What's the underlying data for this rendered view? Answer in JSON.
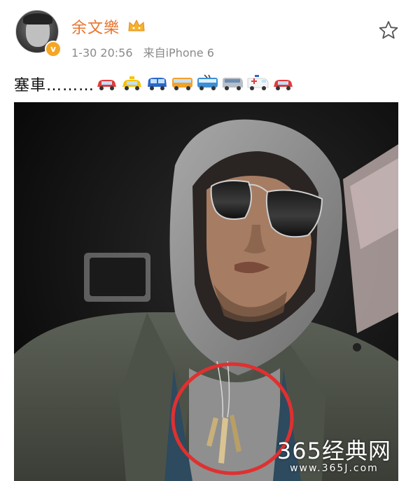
{
  "post": {
    "author_name": "余文樂",
    "date": "1-30 20:56",
    "source": "来自iPhone 6",
    "text": "塞車………",
    "emoji_icons": [
      "red-car-icon",
      "taxi-icon",
      "blue-car-icon",
      "bus-icon",
      "trolleybus-icon",
      "minibus-icon",
      "ambulance-icon",
      "red-car-icon"
    ]
  },
  "watermark": {
    "main": "365经典网",
    "sub": "www.365J.com"
  },
  "colors": {
    "author_name": "#e8742e",
    "meta_text": "#8a8a8a",
    "badge": "#f5a623",
    "highlight_circle": "#e03030"
  }
}
